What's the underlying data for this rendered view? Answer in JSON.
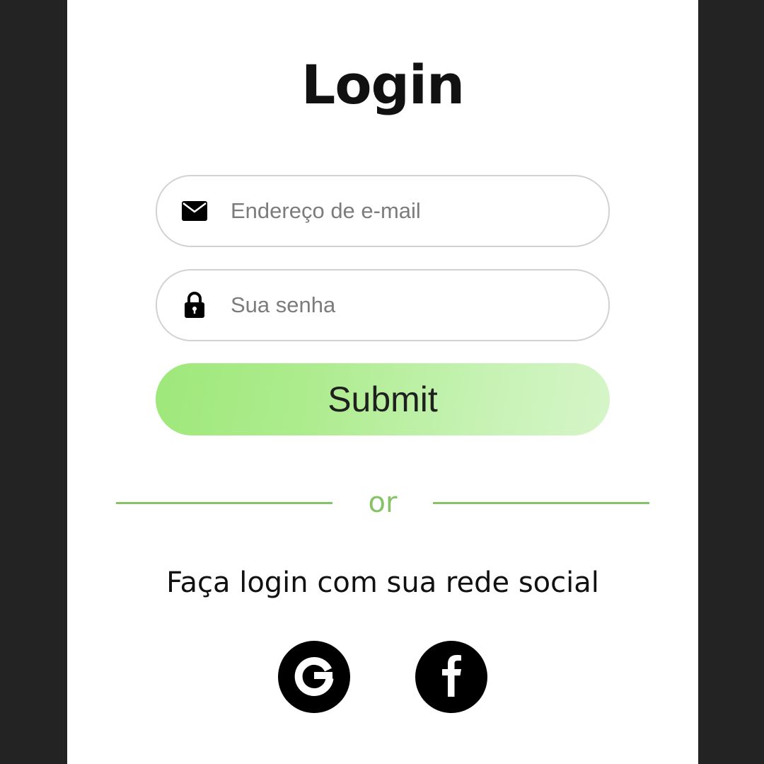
{
  "login": {
    "title": "Login",
    "email": {
      "placeholder": "Endereço de e-mail",
      "value": "",
      "icon": "envelope-icon"
    },
    "password": {
      "placeholder": "Sua senha",
      "value": "",
      "icon": "lock-icon"
    },
    "submit_label": "Submit",
    "divider_text": "or",
    "social_text": "Faça login com sua rede social",
    "social": [
      {
        "name": "Google",
        "icon": "google-icon"
      },
      {
        "name": "Facebook",
        "icon": "facebook-icon"
      }
    ]
  },
  "colors": {
    "background": "#232323",
    "card": "#ffffff",
    "accent": "#86c266",
    "submit_gradient_start": "#9ee87a",
    "submit_gradient_end": "#d6f5c9"
  }
}
